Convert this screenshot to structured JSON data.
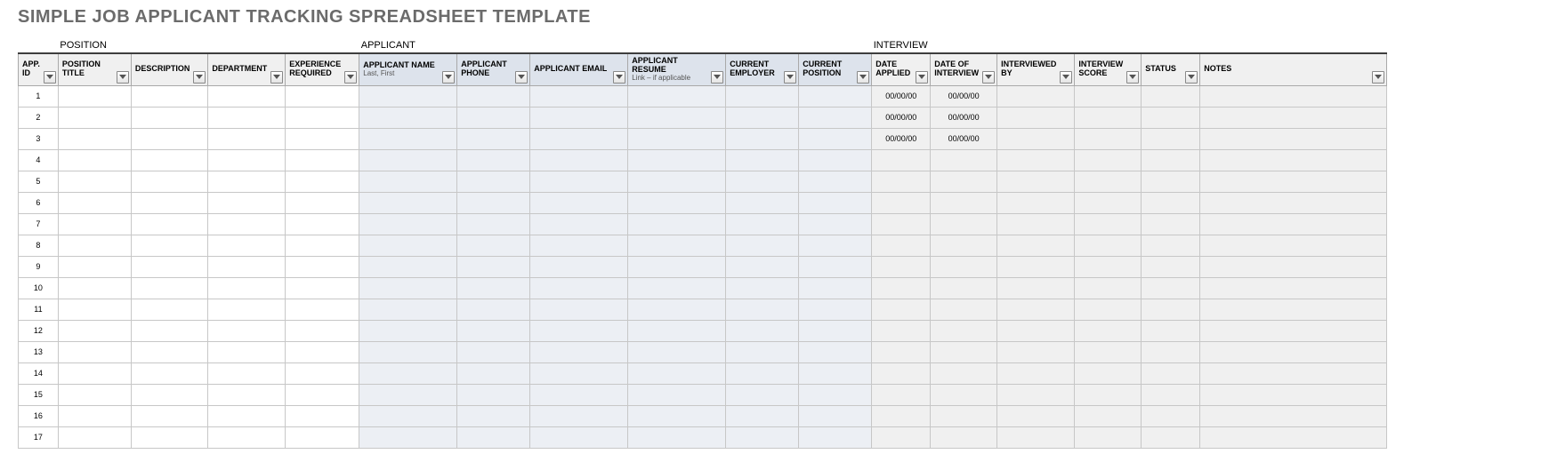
{
  "title": "SIMPLE JOB APPLICANT TRACKING SPREADSHEET TEMPLATE",
  "groups": {
    "position": "POSITION",
    "applicant": "APPLICANT",
    "interview": "INTERVIEW"
  },
  "headers": {
    "app_id": {
      "label": "APP. ID"
    },
    "pos_title": {
      "label": "POSITION TITLE"
    },
    "description": {
      "label": "DESCRIPTION"
    },
    "department": {
      "label": "DEPARTMENT"
    },
    "experience": {
      "label": "EXPERIENCE REQUIRED"
    },
    "app_name": {
      "label": "APPLICANT NAME",
      "sub": "Last, First"
    },
    "app_phone": {
      "label": "APPLICANT PHONE"
    },
    "app_email": {
      "label": "APPLICANT EMAIL"
    },
    "app_resume": {
      "label": "APPLICANT RESUME",
      "sub": "Link – if applicable"
    },
    "cur_emp": {
      "label": "CURRENT EMPLOYER"
    },
    "cur_pos": {
      "label": "CURRENT POSITION"
    },
    "date_app": {
      "label": "DATE APPLIED"
    },
    "date_int": {
      "label": "DATE OF INTERVIEW"
    },
    "int_by": {
      "label": "INTERVIEWED BY"
    },
    "int_score": {
      "label": "INTERVIEW SCORE"
    },
    "status": {
      "label": "STATUS"
    },
    "notes": {
      "label": "NOTES"
    }
  },
  "rows": [
    {
      "id": "1",
      "date_applied": "00/00/00",
      "date_interview": "00/00/00"
    },
    {
      "id": "2",
      "date_applied": "00/00/00",
      "date_interview": "00/00/00"
    },
    {
      "id": "3",
      "date_applied": "00/00/00",
      "date_interview": "00/00/00"
    },
    {
      "id": "4",
      "date_applied": "",
      "date_interview": ""
    },
    {
      "id": "5",
      "date_applied": "",
      "date_interview": ""
    },
    {
      "id": "6",
      "date_applied": "",
      "date_interview": ""
    },
    {
      "id": "7",
      "date_applied": "",
      "date_interview": ""
    },
    {
      "id": "8",
      "date_applied": "",
      "date_interview": ""
    },
    {
      "id": "9",
      "date_applied": "",
      "date_interview": ""
    },
    {
      "id": "10",
      "date_applied": "",
      "date_interview": ""
    },
    {
      "id": "11",
      "date_applied": "",
      "date_interview": ""
    },
    {
      "id": "12",
      "date_applied": "",
      "date_interview": ""
    },
    {
      "id": "13",
      "date_applied": "",
      "date_interview": ""
    },
    {
      "id": "14",
      "date_applied": "",
      "date_interview": ""
    },
    {
      "id": "15",
      "date_applied": "",
      "date_interview": ""
    },
    {
      "id": "16",
      "date_applied": "",
      "date_interview": ""
    },
    {
      "id": "17",
      "date_applied": "",
      "date_interview": ""
    }
  ]
}
